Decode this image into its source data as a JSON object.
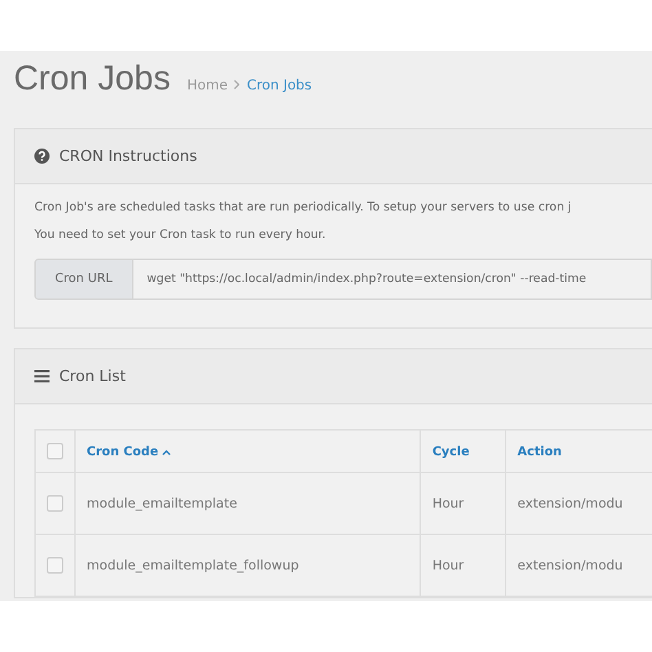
{
  "page": {
    "title": "Cron Jobs",
    "breadcrumb": [
      {
        "label": "Home",
        "selected": false
      },
      {
        "label": "Cron Jobs",
        "selected": true
      }
    ]
  },
  "instructions": {
    "title": "CRON Instructions",
    "paragraphs": [
      "Cron Job's are scheduled tasks that are run periodically. To setup your servers to use cron j",
      "You need to set your Cron task to run every hour."
    ],
    "url_label": "Cron URL",
    "url_value": "wget \"https://oc.local/admin/index.php?route=extension/cron\" --read-time"
  },
  "cron_list": {
    "title": "Cron List",
    "select_all_checked": false,
    "columns": [
      {
        "label": "Cron Code",
        "sorted": true
      },
      {
        "label": "Cycle",
        "sorted": false
      },
      {
        "label": "Action",
        "sorted": false
      }
    ],
    "rows": [
      {
        "checked": false,
        "cells": [
          "module_emailtemplate",
          "Hour",
          "extension/modu"
        ]
      },
      {
        "checked": false,
        "cells": [
          "module_emailtemplate_followup",
          "Hour",
          "extension/modu"
        ]
      }
    ]
  }
}
